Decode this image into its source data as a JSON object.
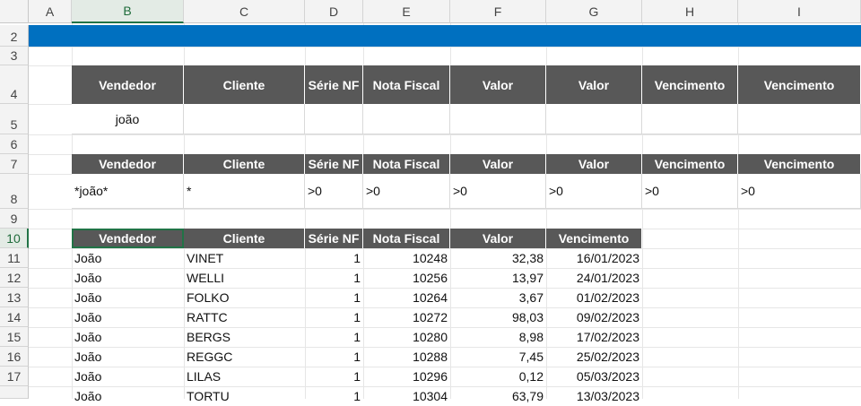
{
  "columns": [
    "A",
    "B",
    "C",
    "D",
    "E",
    "F",
    "G",
    "H",
    "I"
  ],
  "selected_column": "B",
  "selected_row": "10",
  "rows": [
    "2",
    "3",
    "4",
    "5",
    "6",
    "7",
    "8",
    "9",
    "10",
    "11",
    "12",
    "13",
    "14",
    "15",
    "16",
    "17"
  ],
  "colors": {
    "banner": "#0070c0",
    "header_fill": "#585858",
    "selection": "#217346"
  },
  "table1": {
    "headers": [
      "Vendedor",
      "Cliente",
      "Série NF",
      "Nota Fiscal",
      "Valor",
      "Valor",
      "Vencimento",
      "Vencimento"
    ],
    "values": [
      "joão",
      "",
      "",
      "",
      "",
      "",
      "",
      ""
    ]
  },
  "table2": {
    "headers": [
      "Vendedor",
      "Cliente",
      "Série NF",
      "Nota Fiscal",
      "Valor",
      "Valor",
      "Vencimento",
      "Vencimento"
    ],
    "values": [
      "*joão*",
      "*",
      ">0",
      ">0",
      ">0",
      ">0",
      ">0",
      ">0"
    ]
  },
  "table3": {
    "headers": [
      "Vendedor",
      "Cliente",
      "Série NF",
      "Nota Fiscal",
      "Valor",
      "Vencimento"
    ],
    "rows": [
      [
        "João",
        "VINET",
        "1",
        "10248",
        "32,38",
        "16/01/2023"
      ],
      [
        "João",
        "WELLI",
        "1",
        "10256",
        "13,97",
        "24/01/2023"
      ],
      [
        "João",
        "FOLKO",
        "1",
        "10264",
        "3,67",
        "01/02/2023"
      ],
      [
        "João",
        "RATTC",
        "1",
        "10272",
        "98,03",
        "09/02/2023"
      ],
      [
        "João",
        "BERGS",
        "1",
        "10280",
        "8,98",
        "17/02/2023"
      ],
      [
        "João",
        "REGGC",
        "1",
        "10288",
        "7,45",
        "25/02/2023"
      ],
      [
        "João",
        "LILAS",
        "1",
        "10296",
        "0,12",
        "05/03/2023"
      ],
      [
        "João",
        "TORTU",
        "1",
        "10304",
        "63,79",
        "13/03/2023"
      ]
    ]
  }
}
